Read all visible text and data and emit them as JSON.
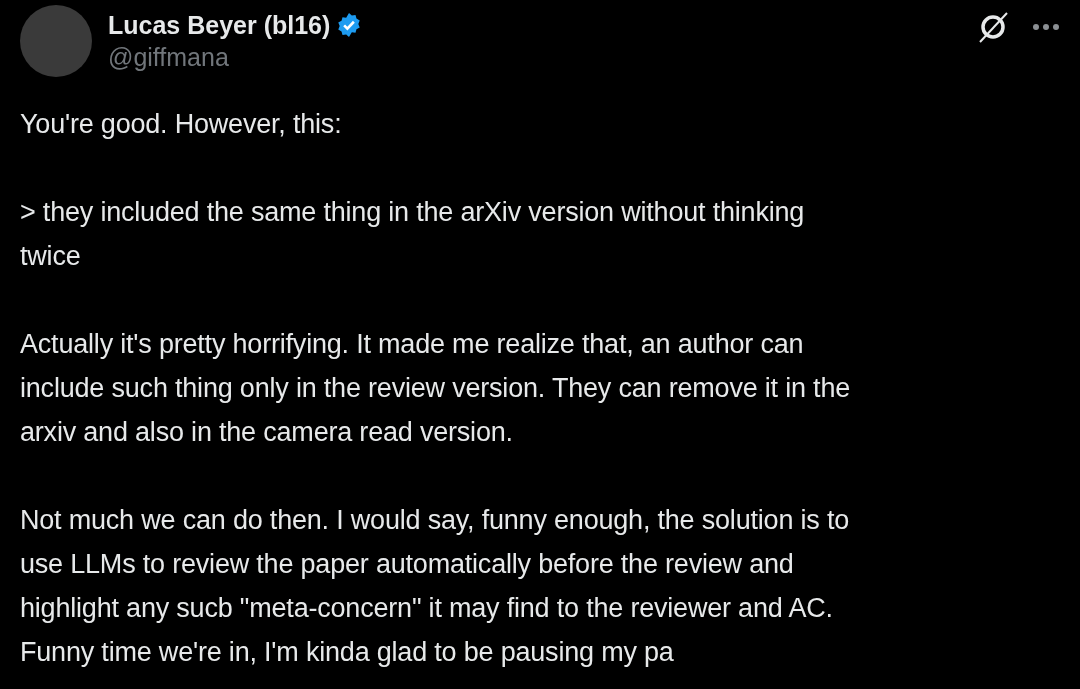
{
  "author": {
    "name": "Lucas Beyer (bl16)",
    "verified": true,
    "handle": "@giffmana"
  },
  "paragraphs": [
    {
      "lines": [
        "You're good. However, this:"
      ]
    },
    {
      "lines": [
        "> they included the same thing in the arXiv version without thinking",
        "twice"
      ]
    },
    {
      "lines": [
        "Actually it's pretty horrifying. It made me realize that, an author can",
        "include such thing only in the review version. They can remove it in the",
        "arxiv and also in the camera read version."
      ]
    },
    {
      "lines": [
        "Not much we can do then. I would say, funny enough, the solution is to",
        "use LLMs to review the paper automatically before the review and",
        "highlight any sucb \"meta-concern\" it may find to the reviewer and AC.",
        "Funny time we're in, I'm kinda glad to be pausing my pa"
      ]
    }
  ]
}
